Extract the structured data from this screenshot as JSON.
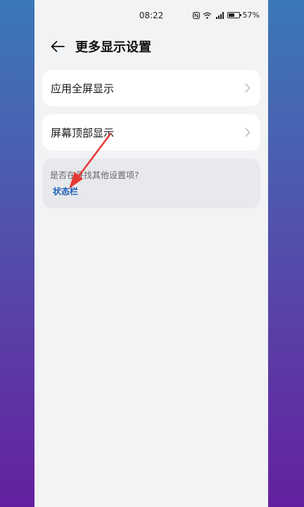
{
  "status_bar": {
    "time": "08:22",
    "battery_text": "57%",
    "battery_level": 0.57,
    "icons": [
      "nfc-icon",
      "wifi-icon",
      "signal-icon",
      "battery-icon"
    ]
  },
  "header": {
    "title": "更多显示设置",
    "back_icon": "back-arrow-icon"
  },
  "settings": {
    "items": [
      {
        "label": "应用全屏显示",
        "icon": "chevron-right-icon"
      },
      {
        "label": "屏幕顶部显示",
        "icon": "chevron-right-icon"
      }
    ]
  },
  "suggestion": {
    "question": "是否在寻找其他设置项?",
    "link": "状态栏"
  },
  "annotation": {
    "arrow_color": "#e53935"
  },
  "colors": {
    "link": "#1f5fb8",
    "page_bg": "#f1f3f5",
    "card_bg": "#ffffff"
  }
}
